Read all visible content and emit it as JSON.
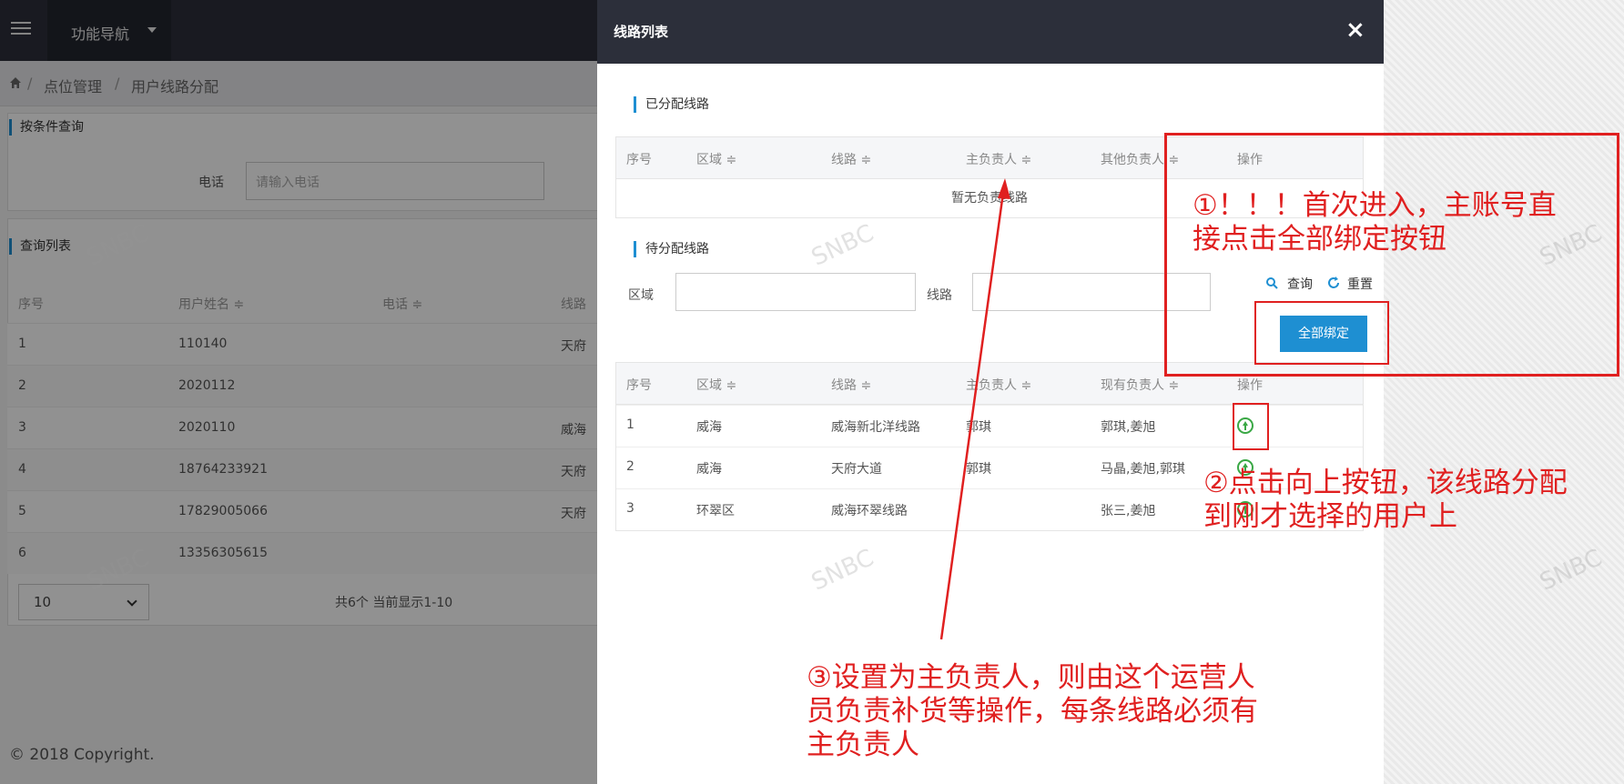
{
  "app": {
    "nav_menu": "功能导航",
    "breadcrumb": [
      "点位管理",
      "用户线路分配"
    ],
    "filter_title": "按条件查询",
    "phone_label": "电话",
    "phone_placeholder": "请输入电话",
    "list_title": "查询列表",
    "columns": [
      "序号",
      "用户姓名 ≑",
      "电话 ≑",
      "线路"
    ],
    "rows": [
      {
        "idx": "1",
        "name": "110140",
        "phone": "",
        "line": "天府"
      },
      {
        "idx": "2",
        "name": "2020112",
        "phone": "",
        "line": ""
      },
      {
        "idx": "3",
        "name": "2020110",
        "phone": "",
        "line": "威海"
      },
      {
        "idx": "4",
        "name": "18764233921",
        "phone": "",
        "line": "天府"
      },
      {
        "idx": "5",
        "name": "17829005066",
        "phone": "",
        "line": "天府"
      },
      {
        "idx": "6",
        "name": "13356305615",
        "phone": "",
        "line": ""
      }
    ],
    "page_size": "10",
    "pager_text": "共6个 当前显示1-10",
    "footer": "© 2018 Copyright."
  },
  "modal": {
    "title": "线路列表",
    "close_label": "×",
    "assigned_title": "已分配线路",
    "assigned_columns": [
      "序号",
      "区域 ≑",
      "线路 ≑",
      "主负责人 ≑",
      "其他负责人 ≑",
      "操作"
    ],
    "assigned_empty": "暂无负责线路",
    "pending_title": "待分配线路",
    "area_label": "区域",
    "line_label": "线路",
    "query_label": "查询",
    "reset_label": "重置",
    "bind_all_label": "全部绑定",
    "pending_columns": [
      "序号",
      "区域 ≑",
      "线路 ≑",
      "主负责人 ≑",
      "现有负责人 ≑",
      "操作"
    ],
    "pending_rows": [
      {
        "idx": "1",
        "area": "威海",
        "line": "威海新北洋线路",
        "main": "郭琪",
        "current": "郭琪,姜旭"
      },
      {
        "idx": "2",
        "area": "威海",
        "line": "天府大道",
        "main": "郭琪",
        "current": "马晶,姜旭,郭琪"
      },
      {
        "idx": "3",
        "area": "环翠区",
        "line": "威海环翠线路",
        "main": "",
        "current": "张三,姜旭"
      }
    ]
  },
  "annotations": {
    "note1_line1": "①！！！首次进入，主账号直",
    "note1_line2": "接点击全部绑定按钮",
    "note2_line1": "②点击向上按钮，该线路分配",
    "note2_line2": "到刚才选择的用户上",
    "note3_line1": "③设置为主负责人，则由这个运营人",
    "note3_line2": "员负责补货等操作，每条线路必须有",
    "note3_line3": "主负责人",
    "watermark": "SNBC",
    "color": "#e02020"
  }
}
